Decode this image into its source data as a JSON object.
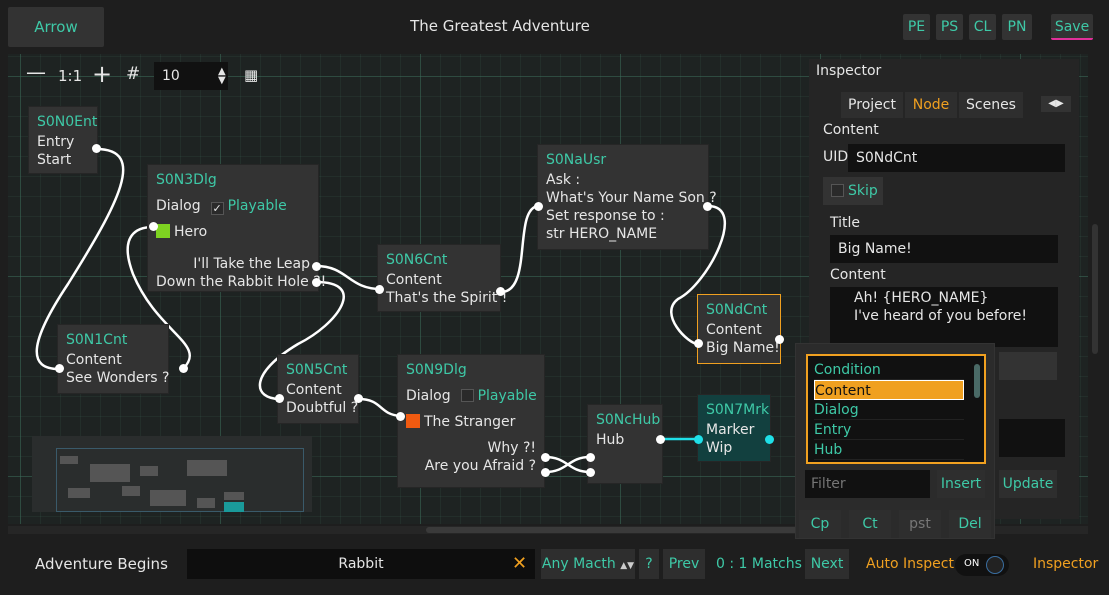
{
  "header": {
    "arrow_label": "Arrow",
    "title": "The Greatest Adventure",
    "buttons": [
      "PE",
      "PS",
      "CL",
      "PN"
    ],
    "save_label": "Save"
  },
  "canvas_toolbar": {
    "zoom_out": "—",
    "reset_zoom": "1:1",
    "zoom_in": "+",
    "grid_value": "10"
  },
  "nodes": {
    "entry": {
      "id": "S0N0Ent",
      "lines": [
        "Entry",
        "Start"
      ]
    },
    "dlg1": {
      "id": "S0N3Dlg",
      "kind": "Dialog",
      "playable": "Playable",
      "character": "Hero",
      "outs": [
        "I'll Take the Leap",
        "Down the Rabbit Hole ?!"
      ]
    },
    "cnt1": {
      "id": "S0N1Cnt",
      "lines": [
        "Content",
        "See Wonders ?"
      ]
    },
    "cnt6": {
      "id": "S0N6Cnt",
      "lines": [
        "Content",
        "That's the Spirit !"
      ]
    },
    "usr": {
      "id": "S0NaUsr",
      "lines": [
        "Ask :",
        "What's Your Name Son ?",
        "Set response to :",
        "str HERO_NAME"
      ]
    },
    "cnt5": {
      "id": "S0N5Cnt",
      "lines": [
        "Content",
        "Doubtful ?"
      ]
    },
    "dlg9": {
      "id": "S0N9Dlg",
      "kind": "Dialog",
      "playable": "Playable",
      "character": "The Stranger",
      "outs": [
        "Why ?!",
        "Are you Afraid ?"
      ]
    },
    "hub": {
      "id": "S0NcHub",
      "lines": [
        "Hub"
      ]
    },
    "mrk": {
      "id": "S0N7Mrk",
      "lines": [
        "Marker",
        "Wip"
      ]
    },
    "dcnt": {
      "id": "S0NdCnt",
      "lines": [
        "Content",
        "Big Name!"
      ]
    }
  },
  "inspector": {
    "title": "Inspector",
    "tabs": [
      "Project",
      "Node",
      "Scenes"
    ],
    "type_label": "Content",
    "uid_label": "UID:",
    "uid_value": "S0NdCnt",
    "skip_label": "Skip",
    "title_label": "Title",
    "title_value": "Big Name!",
    "content_label": "Content",
    "content_value": "Ah! {HERO_NAME}\nI've heard of you before!"
  },
  "insert_popup": {
    "items": [
      "Condition",
      "Content",
      "Dialog",
      "Entry",
      "Hub"
    ],
    "selected": "Content",
    "filter_placeholder": "Filter",
    "insert_label": "Insert",
    "update_label": "Update",
    "actions": [
      "Cp",
      "Ct",
      "pst",
      "Del"
    ]
  },
  "footer": {
    "scene_name": "Adventure Begins",
    "search_value": "Rabbit",
    "match_mode": "Any Macth",
    "help": "?",
    "prev": "Prev",
    "match_count": "0 : 1 Matchs",
    "next": "Next",
    "auto_inspect": "Auto Inspect",
    "toggle_state": "ON",
    "inspector_link": "Inspector"
  },
  "colors": {
    "accent_teal": "#3ec9a7",
    "accent_orange": "#f0a020",
    "hero_color": "#7ed321",
    "stranger_color": "#f05a10",
    "save_underline": "#e0309a",
    "port_marker": "#1fe0e8"
  }
}
